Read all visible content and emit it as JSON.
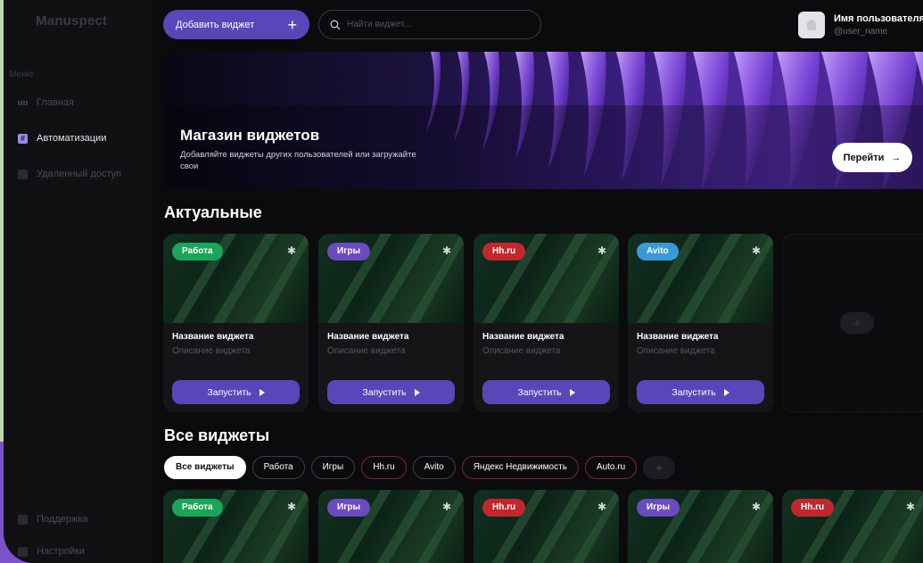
{
  "app": {
    "logo": "Manuspect"
  },
  "sidebar": {
    "menu_title": "Меню",
    "items": [
      {
        "label": "Главная",
        "icon": "grid-icon"
      },
      {
        "label": "Автоматизации",
        "icon": "hash-icon",
        "active": true
      },
      {
        "label": "Удаленный доступ",
        "icon": "remote-icon"
      }
    ],
    "bottom_items": [
      {
        "label": "Поддержка",
        "icon": "support-icon"
      },
      {
        "label": "Настройки",
        "icon": "settings-icon"
      }
    ]
  },
  "header": {
    "add_widget_label": "Добавить виджет",
    "add_widget_icon": "+",
    "search_placeholder": "Найти виджет...",
    "user_name": "Имя пользователя",
    "user_handle": "@user_name"
  },
  "banner": {
    "title": "Магазин виджетов",
    "description": "Добавляйте виджеты других пользователей или загружайте свои",
    "button_label": "Перейти",
    "button_arrow": "→"
  },
  "sections": {
    "actual_title": "Актуальные",
    "all_title": "Все виджеты"
  },
  "actual_cards": [
    {
      "tag": "Работа",
      "tag_color": "#1aa55a",
      "name": "Название виджета",
      "description": "Описание виджета",
      "run_label": "Запустить"
    },
    {
      "tag": "Игры",
      "tag_color": "#6a4bc0",
      "name": "Название виджета",
      "description": "Описание виджета",
      "run_label": "Запустить"
    },
    {
      "tag": "Hh.ru",
      "tag_color": "#c0282e",
      "name": "Название виджета",
      "description": "Описание виджета",
      "run_label": "Запустить"
    },
    {
      "tag": "Avito",
      "tag_color": "#3a9ad8",
      "name": "Название виджета",
      "description": "Описание виджета",
      "run_label": "Запустить"
    }
  ],
  "add_card_icon": "+",
  "filters": [
    {
      "label": "Все виджеты",
      "active": true
    },
    {
      "label": "Работа"
    },
    {
      "label": "Игры"
    },
    {
      "label": "Hh.ru",
      "red": true
    },
    {
      "label": "Avito"
    },
    {
      "label": "Яндекс Недвижимость",
      "red": true
    },
    {
      "label": "Auto.ru",
      "red": true
    },
    {
      "label": "+",
      "plus": true
    }
  ],
  "all_cards": [
    {
      "tag": "Работа",
      "tag_color": "#1aa55a"
    },
    {
      "tag": "Игры",
      "tag_color": "#6a4bc0"
    },
    {
      "tag": "Hh.ru",
      "tag_color": "#c0282e"
    },
    {
      "tag": "Игры",
      "tag_color": "#6a4bc0"
    },
    {
      "tag": "Hh.ru",
      "tag_color": "#c0282e"
    }
  ],
  "colors": {
    "accent": "#5a46b8",
    "background": "#0b0b0d",
    "sidebar": "#111114"
  }
}
